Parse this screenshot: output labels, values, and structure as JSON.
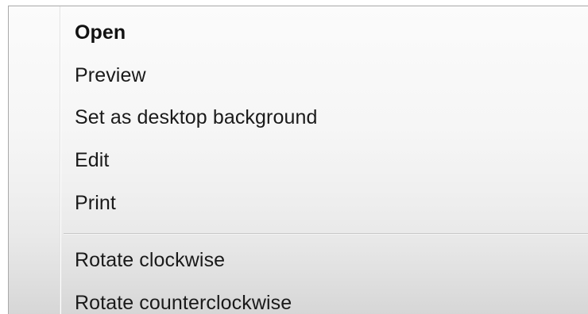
{
  "context_menu": {
    "items": [
      {
        "label": "Open",
        "default": true
      },
      {
        "label": "Preview"
      },
      {
        "label": "Set as desktop background"
      },
      {
        "label": "Edit"
      },
      {
        "label": "Print"
      },
      {
        "label": "Rotate clockwise"
      },
      {
        "label": "Rotate counterclockwise"
      }
    ]
  }
}
